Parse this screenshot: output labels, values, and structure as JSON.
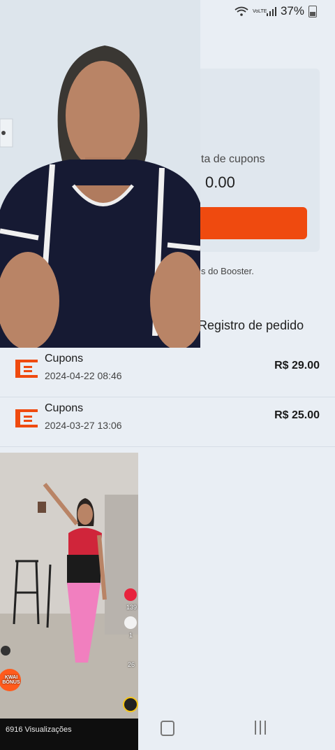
{
  "status_bar": {
    "network_label": "VoLTE",
    "battery": "37%"
  },
  "coupon_card": {
    "coupon_label": "ta de cupons",
    "coupon_value": "0.00",
    "booster_text": "s do Booster."
  },
  "order_record_title": "Registro de pedido",
  "orders": [
    {
      "title": "Cupons",
      "date": "2024-04-22 08:46",
      "amount": "R$ 29.00"
    },
    {
      "title": "Cupons",
      "date": "2024-03-27 13:06",
      "amount": "R$ 25.00"
    }
  ],
  "video_overlay": {
    "views": "6916 Visualizações",
    "badge": "KWAI BÔNUS",
    "like_count": "139",
    "comment_count": "1",
    "share_count": "26"
  },
  "colors": {
    "accent_orange": "#ef4a0f",
    "background": "#e9eef4"
  }
}
